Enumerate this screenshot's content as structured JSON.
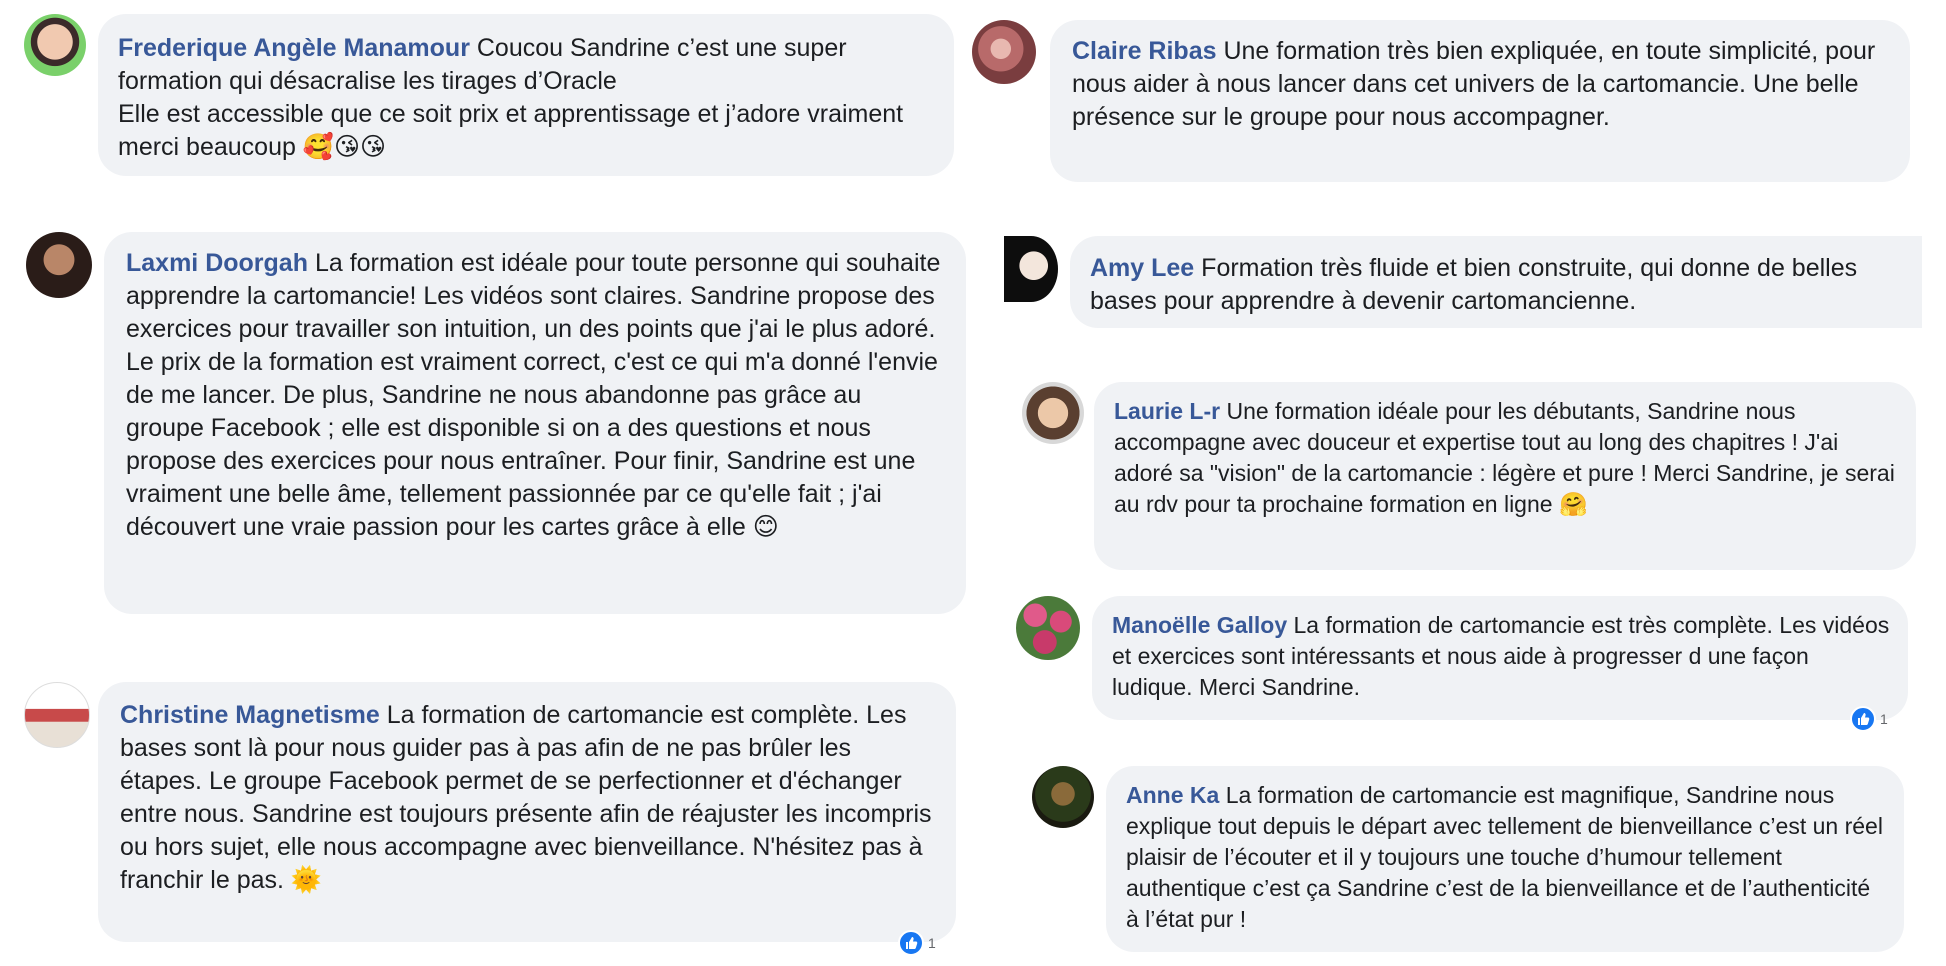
{
  "comments": [
    {
      "name": "Frederique Angèle Manamour",
      "lines": [
        "Coucou Sandrine c’est une super formation qui désacralise les tirages d’Oracle",
        "Elle est accessible que ce soit prix et apprentissage et j’adore vraiment merci beaucoup 🥰😘😘"
      ]
    },
    {
      "name": "Laxmi Doorgah",
      "lines": [
        "La formation est idéale pour toute personne qui souhaite apprendre la cartomancie! Les vidéos sont claires. Sandrine propose des exercices pour travailler son intuition, un des points que j'ai le plus adoré. Le prix de la formation est vraiment correct, c'est ce qui m'a donné l'envie de me lancer. De plus, Sandrine ne nous abandonne pas grâce au groupe Facebook ; elle est disponible si on a des questions et nous propose des exercices pour nous entraîner. Pour finir, Sandrine est une vraiment une belle âme, tellement passionnée par ce qu'elle fait ; j'ai découvert une vraie passion pour les cartes grâce à elle 😊"
      ]
    },
    {
      "name": "Christine Magnetisme",
      "lines": [
        "La formation de cartomancie est complète. Les bases sont là pour nous guider pas à pas afin de ne pas brûler les étapes. Le groupe Facebook permet de se perfectionner et d'échanger entre nous. Sandrine est toujours présente afin de réajuster les incompris ou hors sujet, elle nous accompagne avec bienveillance. N'hésitez pas à franchir le pas. 🌞"
      ]
    },
    {
      "name": "Claire Ribas",
      "lines": [
        "Une formation très bien expliquée, en toute simplicité, pour nous aider à nous lancer dans cet univers de la cartomancie. Une belle présence sur le groupe pour nous accompagner."
      ]
    },
    {
      "name": "Amy Lee",
      "lines": [
        "Formation très fluide et bien construite, qui donne de belles bases pour apprendre à devenir cartomancienne."
      ]
    },
    {
      "name": "Laurie L-r",
      "lines": [
        "Une formation idéale pour les débutants, Sandrine nous accompagne avec douceur et expertise tout au long des chapitres ! J'ai adoré sa \"vision\" de la cartomancie : légère et pure ! Merci Sandrine, je serai au rdv pour ta prochaine formation en ligne 🤗"
      ]
    },
    {
      "name": "Manoëlle Galloy",
      "lines": [
        "La formation de cartomancie est très complète. Les vidéos et exercices sont intéressants et nous aide à progresser d une façon ludique. Merci Sandrine."
      ],
      "reaction_count": "1"
    },
    {
      "name": "Anne Ka",
      "lines": [
        "La formation de cartomancie est magnifique, Sandrine nous explique tout depuis le départ avec tellement de bienveillance c’est un réel plaisir de l’écouter et il y toujours une touche d’humour tellement authentique c’est ça Sandrine c’est de la bienveillance et de l’authenticité à l’état pur !"
      ]
    }
  ],
  "christine_reaction_count": "1",
  "colors": {
    "bubble": "#f0f2f5",
    "name": "#385898",
    "text": "#1c1e21",
    "like": "#1877f2"
  }
}
